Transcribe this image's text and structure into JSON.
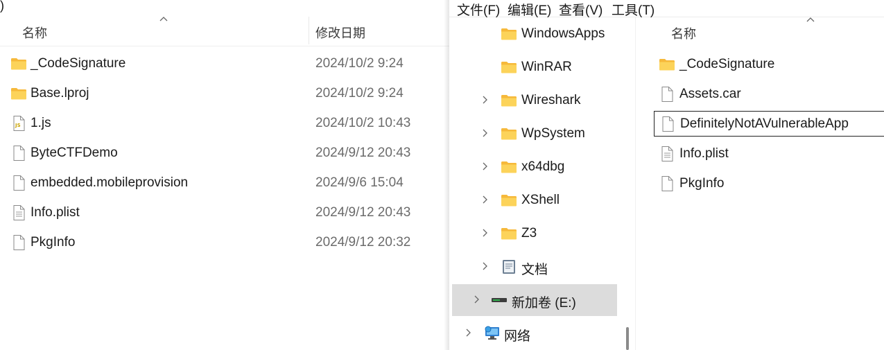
{
  "left_window": {
    "paren": ")",
    "columns": {
      "name": "名称",
      "date": "修改日期"
    },
    "files": [
      {
        "name": "_CodeSignature",
        "date": "2024/10/2 9:24",
        "icon": "folder-icon"
      },
      {
        "name": "Base.lproj",
        "date": "2024/10/2 9:24",
        "icon": "folder-icon"
      },
      {
        "name": "1.js",
        "date": "2024/10/2 10:43",
        "icon": "js-file-icon"
      },
      {
        "name": "ByteCTFDemo",
        "date": "2024/9/12 20:43",
        "icon": "file-icon"
      },
      {
        "name": "embedded.mobileprovision",
        "date": "2024/9/6 15:04",
        "icon": "file-icon"
      },
      {
        "name": "Info.plist",
        "date": "2024/9/12 20:43",
        "icon": "text-file-icon"
      },
      {
        "name": "PkgInfo",
        "date": "2024/9/12 20:32",
        "icon": "file-icon"
      }
    ]
  },
  "right_window": {
    "menu": [
      {
        "label": "文件(F)"
      },
      {
        "label": "编辑(E)"
      },
      {
        "label": "查看(V)"
      },
      {
        "label": "工具(T)"
      }
    ],
    "nav": [
      {
        "label": "WindowsApps",
        "icon": "folder-icon",
        "expandable": false
      },
      {
        "label": "WinRAR",
        "icon": "folder-icon",
        "expandable": false
      },
      {
        "label": "Wireshark",
        "icon": "folder-icon",
        "expandable": true
      },
      {
        "label": "WpSystem",
        "icon": "folder-icon",
        "expandable": true
      },
      {
        "label": "x64dbg",
        "icon": "folder-icon",
        "expandable": true
      },
      {
        "label": "XShell",
        "icon": "folder-icon",
        "expandable": true
      },
      {
        "label": "Z3",
        "icon": "folder-icon",
        "expandable": true
      },
      {
        "label": "文档",
        "icon": "documents-icon",
        "expandable": true
      },
      {
        "label": "新加卷 (E:)",
        "icon": "drive-icon",
        "expandable": true,
        "selected": true
      },
      {
        "label": "网络",
        "icon": "network-icon",
        "expandable": true
      }
    ],
    "columns": {
      "name": "名称"
    },
    "files": [
      {
        "name": "_CodeSignature",
        "icon": "folder-icon"
      },
      {
        "name": "Assets.car",
        "icon": "file-icon"
      },
      {
        "name": "DefinitelyNotAVulnerableApp",
        "icon": "file-icon",
        "focused": true
      },
      {
        "name": "Info.plist",
        "icon": "text-file-icon"
      },
      {
        "name": "PkgInfo",
        "icon": "file-icon"
      }
    ]
  },
  "colors": {
    "folder": "#f8c84a",
    "selection": "#dcdcdc",
    "date_text": "#6b6b6b"
  }
}
